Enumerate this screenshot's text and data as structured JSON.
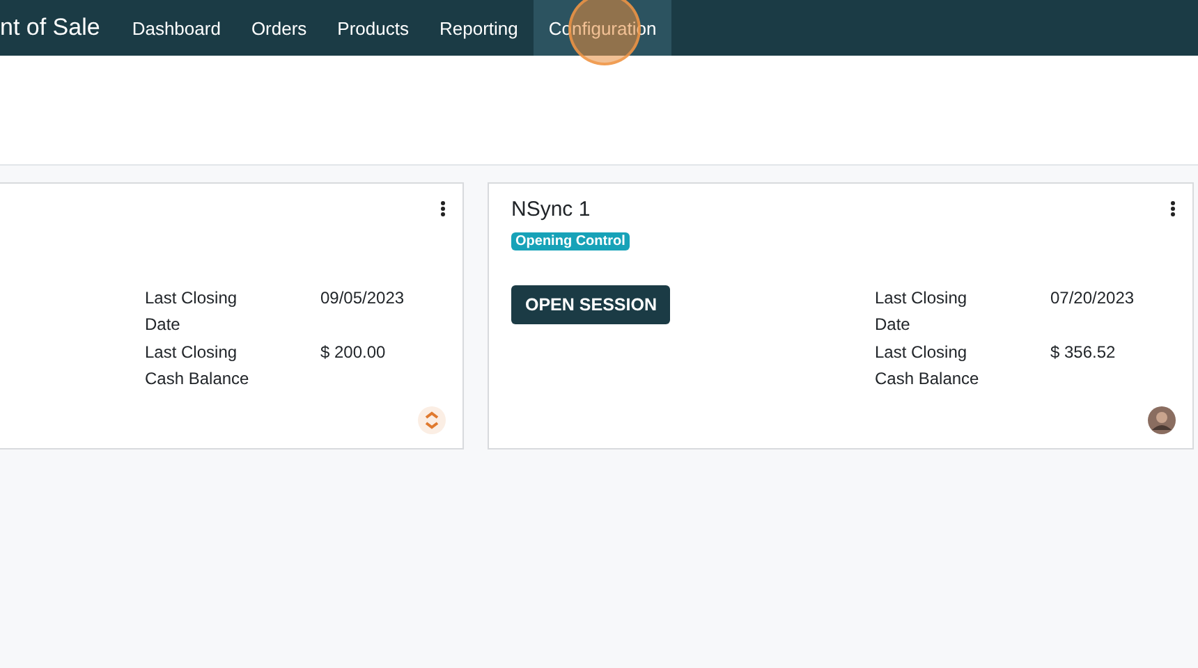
{
  "navbar": {
    "app_title": "nt of Sale",
    "menu": [
      {
        "label": "Dashboard",
        "selected": false
      },
      {
        "label": "Orders",
        "selected": false
      },
      {
        "label": "Products",
        "selected": false
      },
      {
        "label": "Reporting",
        "selected": false
      },
      {
        "label": "Configuration",
        "selected": true
      }
    ]
  },
  "cards": [
    {
      "stats": [
        {
          "label": "Last Closing Date",
          "value": "09/05/2023"
        },
        {
          "label": "Last Closing Cash Balance",
          "value": "$ 200.00"
        }
      ],
      "avatar": {
        "kind": "logo"
      }
    },
    {
      "title": "NSync 1",
      "badge": "Opening Control",
      "button": "OPEN SESSION",
      "stats": [
        {
          "label": "Last Closing Date",
          "value": "07/20/2023"
        },
        {
          "label": "Last Closing Cash Balance",
          "value": "$ 356.52"
        }
      ],
      "avatar": {
        "kind": "person"
      }
    }
  ]
}
